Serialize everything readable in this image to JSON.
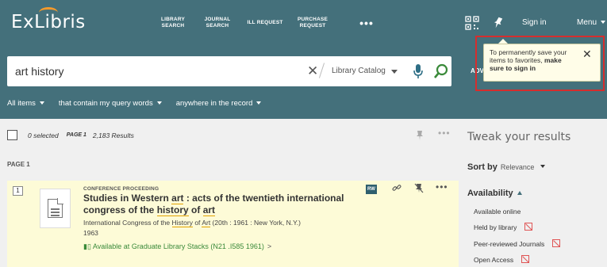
{
  "header": {
    "logo": "ExLibris",
    "nav": [
      {
        "line1": "LIBRARY",
        "line2": "SEARCH"
      },
      {
        "line1": "JOURNAL",
        "line2": "SEARCH"
      },
      {
        "line1": "ILL REQUEST",
        "line2": ""
      },
      {
        "line1": "PURCHASE",
        "line2": "REQUEST"
      }
    ],
    "more": "•••",
    "sign_in": "Sign in",
    "menu": "Menu"
  },
  "search": {
    "query": "art history",
    "clear": "✕",
    "scope": "Library Catalog",
    "advanced": "ADV",
    "filters": [
      "All items",
      "that contain my query words",
      "anywhere in the record"
    ]
  },
  "tooltip": {
    "text": "To permanently save your items to favorites,",
    "bold": "make sure to sign in",
    "close": "✕"
  },
  "results": {
    "selected": "0 selected",
    "page": "PAGE 1",
    "count": "2,183 Results",
    "page_label": "PAGE 1",
    "more": "•••"
  },
  "record": {
    "number": "1",
    "type": "CONFERENCE PROCEEDING",
    "title_parts": [
      "Studies in Western ",
      "art",
      " : acts of the twentieth international congress of the ",
      "history",
      " of ",
      "art"
    ],
    "meta_parts": [
      "International Congress of the ",
      "History",
      " of ",
      "Art",
      " (20th : 1961 : New York, N.Y.)"
    ],
    "year": "1963",
    "availability": "Available at",
    "location": "Graduate Library  Stacks (N21 .I585 1961)",
    "arrow": ">",
    "rw": "RW",
    "more": "•••"
  },
  "facets": {
    "tweak": "Tweak your results",
    "sort_label": "Sort by",
    "sort_value": "Relevance",
    "availability_head": "Availability",
    "items": [
      "Available online",
      "Held by library",
      "Peer-reviewed Journals",
      "Open Access"
    ]
  },
  "colors": {
    "header_bg": "#44707b",
    "highlight_card": "#fdfbd7",
    "available_green": "#3a8a3a",
    "callout_red": "#d62d2d"
  }
}
